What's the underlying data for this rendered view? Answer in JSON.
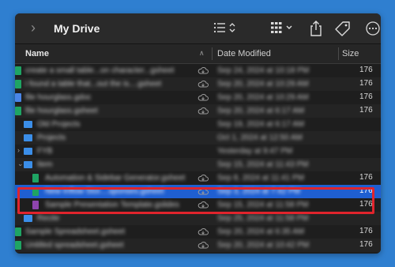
{
  "window": {
    "title": "My Drive"
  },
  "toolbar": {
    "icons": [
      "chevron-right-icon",
      "list-view-icon",
      "grid-view-icon",
      "share-icon",
      "tag-icon",
      "more-icon"
    ]
  },
  "header": {
    "name": "Name",
    "date_modified": "Date Modified",
    "size": "Size"
  },
  "rows": [
    {
      "kind": "sheet",
      "name": "create a small table...on character...gsheet",
      "date": "Sep 24, 2024 at 10:18 PM",
      "size": "176"
    },
    {
      "kind": "sheet",
      "name": "i found a table that...out the is....gsheet",
      "date": "Sep 20, 2024 at 10:29 AM",
      "size": "176"
    },
    {
      "kind": "doc",
      "name": "file hourglass.gdoc",
      "date": "Sep 20, 2024 at 10:29 AM",
      "size": "176"
    },
    {
      "kind": "sheet",
      "name": "file hourglass.gsheet",
      "date": "Sep 20, 2024 at 6:17 AM",
      "size": "176"
    },
    {
      "kind": "folder",
      "name": "Old Projects",
      "date": "Sep 19, 2024 at 6:17 AM",
      "size": ""
    },
    {
      "kind": "folder",
      "name": "Projects",
      "date": "Oct 1, 2024 at 12:50 AM",
      "size": ""
    },
    {
      "kind": "folder",
      "expanded": false,
      "name": "FYB",
      "date": "Yesterday at 9:47 PM",
      "size": ""
    },
    {
      "kind": "folder",
      "expanded": true,
      "name": "Item",
      "date": "Sep 15, 2024 at 11:43 PM",
      "size": ""
    },
    {
      "kind": "sheet",
      "indent": true,
      "name": "Automation & Sidebar Generator.gsheet",
      "date": "Sep 8, 2024 at 11:41 PM",
      "size": "176"
    },
    {
      "kind": "sheet",
      "indent": true,
      "selected": true,
      "name": "New Inflow Stor....sponses.gsheet",
      "date": "Sep 3, 2024 at 7:42 PM",
      "size": "176"
    },
    {
      "kind": "slides",
      "indent": true,
      "name": "Sample Presentation Template.gslides",
      "date": "Sep 15, 2024 at 11:58 PM",
      "size": "176"
    },
    {
      "kind": "folder",
      "name": "Recite",
      "date": "Sep 25, 2024 at 11:58 PM",
      "size": ""
    },
    {
      "kind": "sheet",
      "name": "Sample Spreadsheet.gsheet",
      "date": "Sep 20, 2024 at 6:35 AM",
      "size": "176"
    },
    {
      "kind": "sheet",
      "name": "Untitled spreadsheet.gsheet",
      "date": "Sep 20, 2024 at 10:42 PM",
      "size": "176"
    }
  ],
  "colors": {
    "background": "#2f7fd0",
    "window": "#1e1e1e",
    "selection": "#1f5fd1",
    "highlight_box": "#e0242c",
    "sheet": "#1fa463",
    "folder": "#3b8ee8"
  }
}
